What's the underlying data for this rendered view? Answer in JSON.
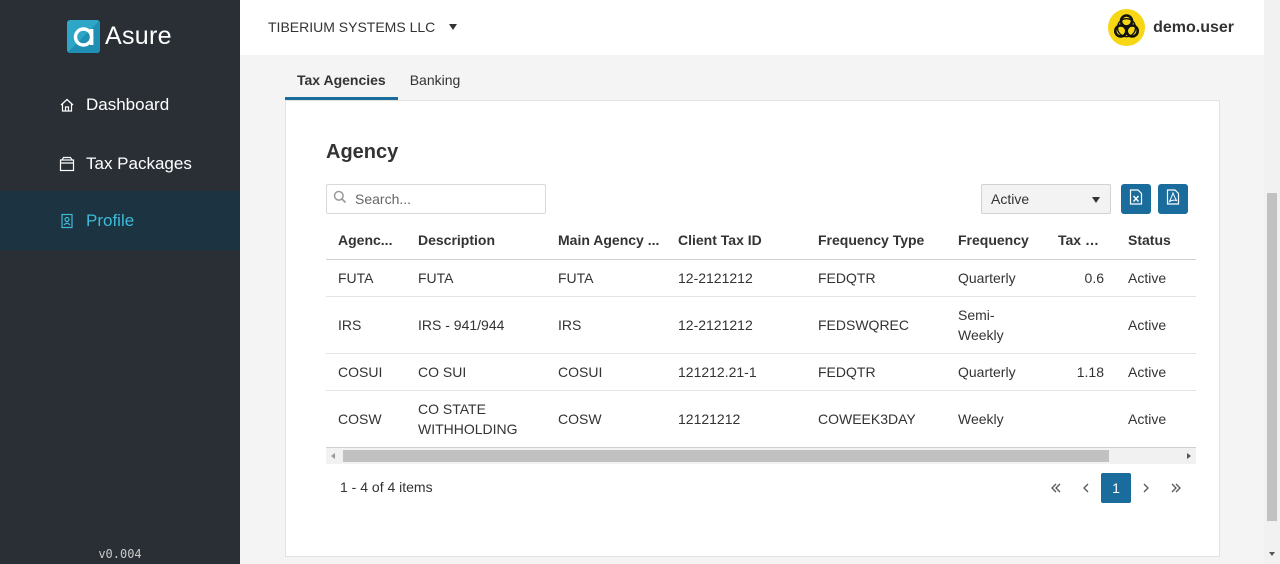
{
  "sidebar": {
    "brand": "Asure",
    "items": [
      {
        "label": "Dashboard",
        "icon": "home-icon"
      },
      {
        "label": "Tax Packages",
        "icon": "package-icon"
      },
      {
        "label": "Profile",
        "icon": "profile-icon",
        "active": true
      }
    ],
    "version": "v0.004"
  },
  "header": {
    "company": "TIBERIUM SYSTEMS LLC",
    "username": "demo.user",
    "avatar_icon": "biohazard-icon"
  },
  "tabs": [
    {
      "label": "Tax Agencies",
      "active": true
    },
    {
      "label": "Banking",
      "active": false
    }
  ],
  "agency": {
    "title": "Agency",
    "search": {
      "placeholder": "Search...",
      "value": ""
    },
    "status_filter": "Active",
    "export_excel_icon": "excel-icon",
    "export_pdf_icon": "pdf-icon",
    "columns": [
      "Agenc...",
      "Description",
      "Main Agency ...",
      "Client Tax ID",
      "Frequency Type",
      "Frequency",
      "Tax Rate",
      "Status"
    ],
    "rows": [
      {
        "agency": "FUTA",
        "description": "FUTA",
        "main_agency": "FUTA",
        "client_tax_id": "12-2121212",
        "frequency_type": "FEDQTR",
        "frequency": "Quarterly",
        "tax_rate": "0.6",
        "status": "Active"
      },
      {
        "agency": "IRS",
        "description": "IRS - 941/944",
        "main_agency": "IRS",
        "client_tax_id": "12-2121212",
        "frequency_type": "FEDSWQREC",
        "frequency": "Semi-Weekly",
        "tax_rate": "",
        "status": "Active"
      },
      {
        "agency": "COSUI",
        "description": "CO SUI",
        "main_agency": "COSUI",
        "client_tax_id": "121212.21-1",
        "frequency_type": "FEDQTR",
        "frequency": "Quarterly",
        "tax_rate": "1.18",
        "status": "Active"
      },
      {
        "agency": "COSW",
        "description": "CO STATE WITHHOLDING",
        "main_agency": "COSW",
        "client_tax_id": "12121212",
        "frequency_type": "COWEEK3DAY",
        "frequency": "Weekly",
        "tax_rate": "",
        "status": "Active"
      }
    ],
    "pager": {
      "info": "1 - 4 of 4 items",
      "current_page": "1"
    }
  },
  "colors": {
    "sidebar_bg": "#2a2f36",
    "sidebar_active_bg": "#1c3442",
    "accent": "#3dbad8",
    "primary": "#1a6c9c"
  }
}
